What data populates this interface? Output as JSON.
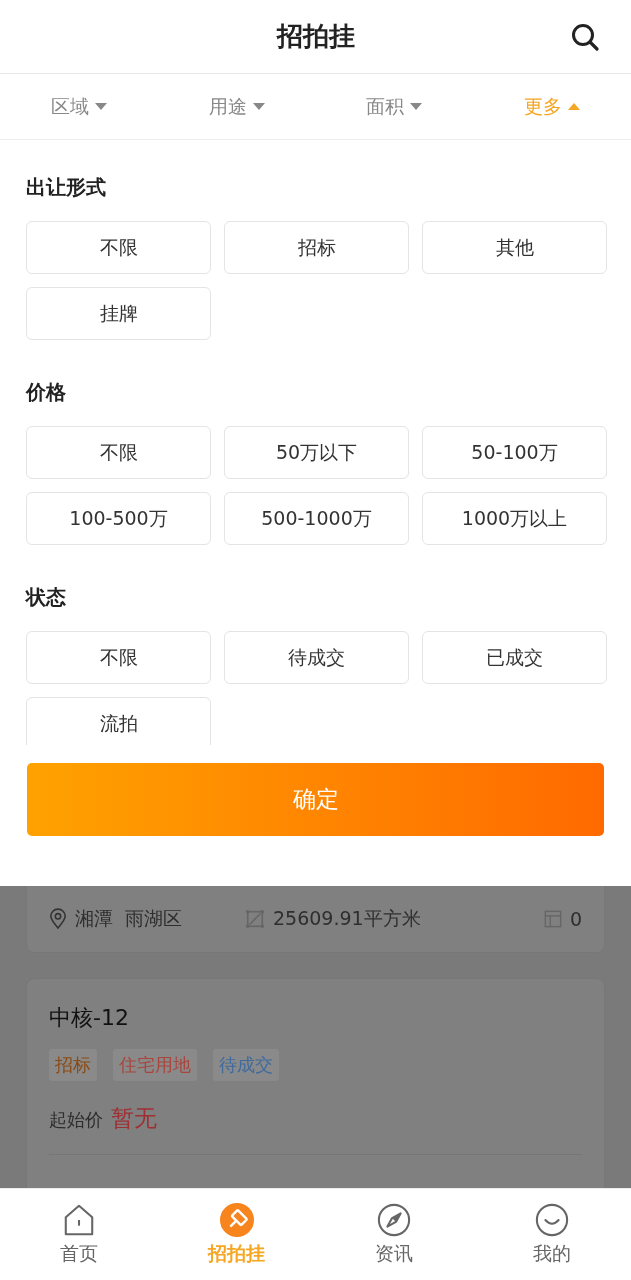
{
  "header": {
    "title": "招拍挂"
  },
  "filters": [
    {
      "label": "区域",
      "selected": false
    },
    {
      "label": "用途",
      "selected": false
    },
    {
      "label": "面积",
      "selected": false
    },
    {
      "label": "更多",
      "selected": true
    }
  ],
  "sections": [
    {
      "title": "出让形式",
      "options": [
        {
          "label": "不限",
          "selected": false
        },
        {
          "label": "招标",
          "selected": false
        },
        {
          "label": "其他",
          "selected": false
        },
        {
          "label": "挂牌",
          "selected": false
        }
      ]
    },
    {
      "title": "价格",
      "options": [
        {
          "label": "不限",
          "selected": false
        },
        {
          "label": "50万以下",
          "selected": false
        },
        {
          "label": "50-100万",
          "selected": false
        },
        {
          "label": "100-500万",
          "selected": false
        },
        {
          "label": "500-1000万",
          "selected": false
        },
        {
          "label": "1000万以上",
          "selected": false
        }
      ]
    },
    {
      "title": "状态",
      "options": [
        {
          "label": "不限",
          "selected": false
        },
        {
          "label": "待成交",
          "selected": false
        },
        {
          "label": "已成交",
          "selected": false
        },
        {
          "label": "流拍",
          "selected": false
        }
      ]
    }
  ],
  "confirm_button": "确定",
  "listings": [
    {
      "location": "湘潭  雨湖区",
      "area": "25609.91平方米",
      "count": "0"
    },
    {
      "title": "中核-12",
      "tags": [
        {
          "label": "招标",
          "color": "#8a4a12"
        },
        {
          "label": "住宅用地",
          "color": "#a8463e"
        },
        {
          "label": "待成交",
          "color": "#3e6a9e"
        }
      ],
      "price_label": "起始价",
      "price": "暂无"
    }
  ],
  "nav": [
    {
      "label": "首页",
      "selected": false
    },
    {
      "label": "招拍挂",
      "selected": true
    },
    {
      "label": "资讯",
      "selected": false
    },
    {
      "label": "我的",
      "selected": false
    }
  ]
}
